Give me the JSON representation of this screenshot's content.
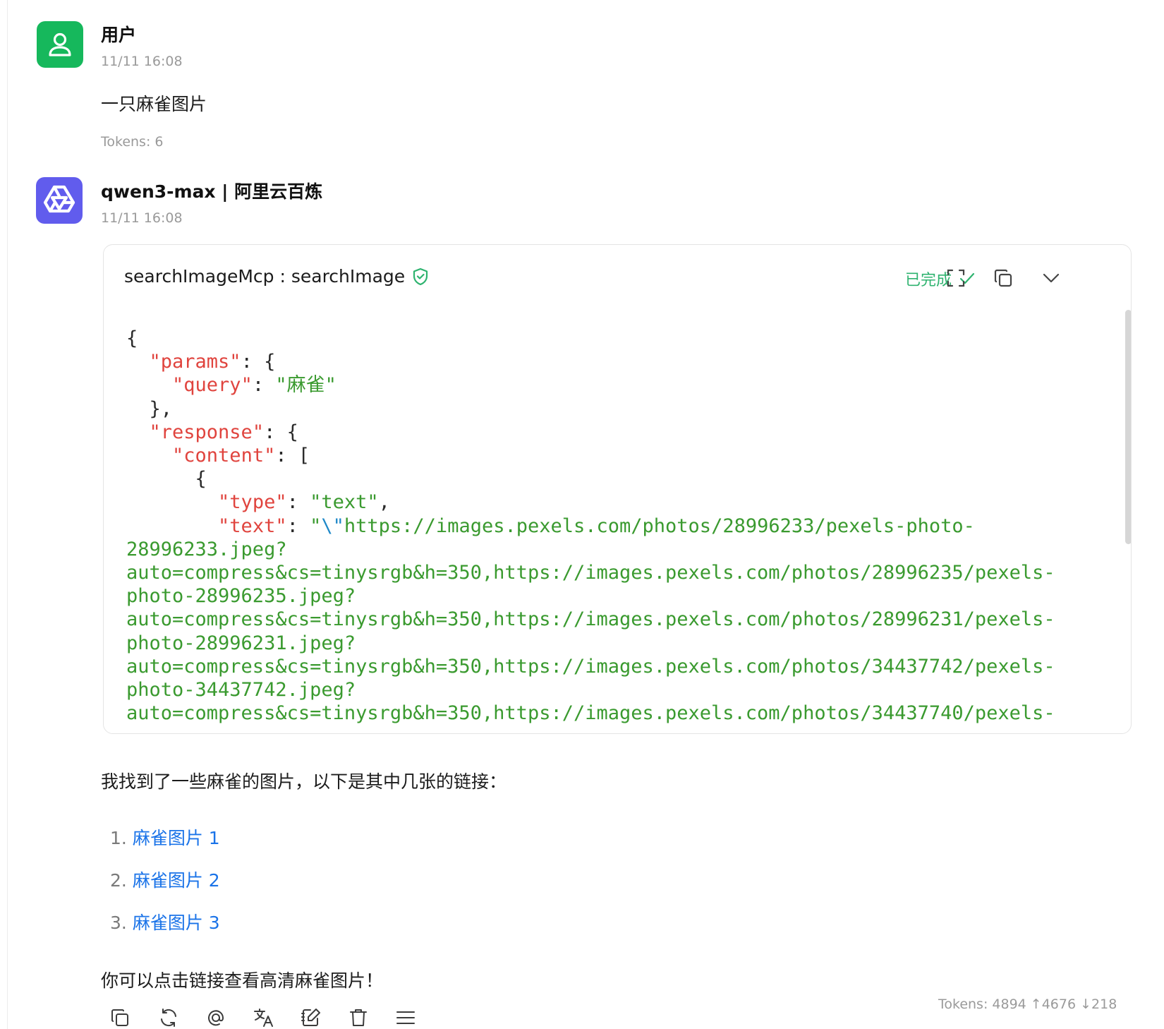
{
  "user_message": {
    "author": "用户",
    "time": "11/11 16:08",
    "text": "一只麻雀图片",
    "tokens": "Tokens: 6",
    "avatar_icon": "user-icon",
    "avatar_color": "#16b85c"
  },
  "assistant_message": {
    "author": "qwen3-max | 阿里云百炼",
    "time": "11/11 16:08",
    "avatar_icon": "qwen-logo-icon",
    "avatar_color": "#615ced",
    "tool_call": {
      "title": "searchImageMcp : searchImage",
      "status": "已完成",
      "status_color": "#2eb36f",
      "code": {
        "l1": "{",
        "l2_key": "\"params\"",
        "l2_rest": ": {",
        "l3_key": "\"query\"",
        "l3_colon": ": ",
        "l3_val": "\"麻雀\"",
        "l4": "},",
        "l5_key": "\"response\"",
        "l5_rest": ": {",
        "l6_key": "\"content\"",
        "l6_rest": ": [",
        "l7": "{",
        "l8_key": "\"type\"",
        "l8_colon": ": ",
        "l8_val": "\"text\"",
        "l8_comma": ",",
        "l9_key": "\"text\"",
        "l9_colon": ": ",
        "l9_q": "\"",
        "l9_esc": "\\\"",
        "l9_val": "https://images.pexels.com/photos/28996233/pexels-photo-",
        "l10": "28996233.jpeg?",
        "l11": "auto=compress&cs=tinysrgb&h=350,https://images.pexels.com/photos/28996235/pexels-",
        "l12": "photo-28996235.jpeg?",
        "l13": "auto=compress&cs=tinysrgb&h=350,https://images.pexels.com/photos/28996231/pexels-",
        "l14": "photo-28996231.jpeg?",
        "l15": "auto=compress&cs=tinysrgb&h=350,https://images.pexels.com/photos/34437742/pexels-",
        "l16": "photo-34437742.jpeg?",
        "l17": "auto=compress&cs=tinysrgb&h=350,https://images.pexels.com/photos/34437740/pexels-"
      }
    },
    "intro": "我找到了一些麻雀的图片，以下是其中几张的链接：",
    "links": [
      {
        "num": "1.",
        "label": "麻雀图片 1"
      },
      {
        "num": "2.",
        "label": "麻雀图片 2"
      },
      {
        "num": "3.",
        "label": "麻雀图片 3"
      }
    ],
    "outro": "你可以点击链接查看高清麻雀图片！",
    "tokens": "Tokens: 4894 ↑4676 ↓218",
    "actions": [
      "copy-icon",
      "regenerate-icon",
      "mention-icon",
      "translate-icon",
      "edit-icon",
      "delete-icon",
      "more-menu-icon"
    ]
  },
  "colors": {
    "link": "#1a73e8",
    "json_key": "#e0443e",
    "json_string": "#3a9a2f"
  }
}
